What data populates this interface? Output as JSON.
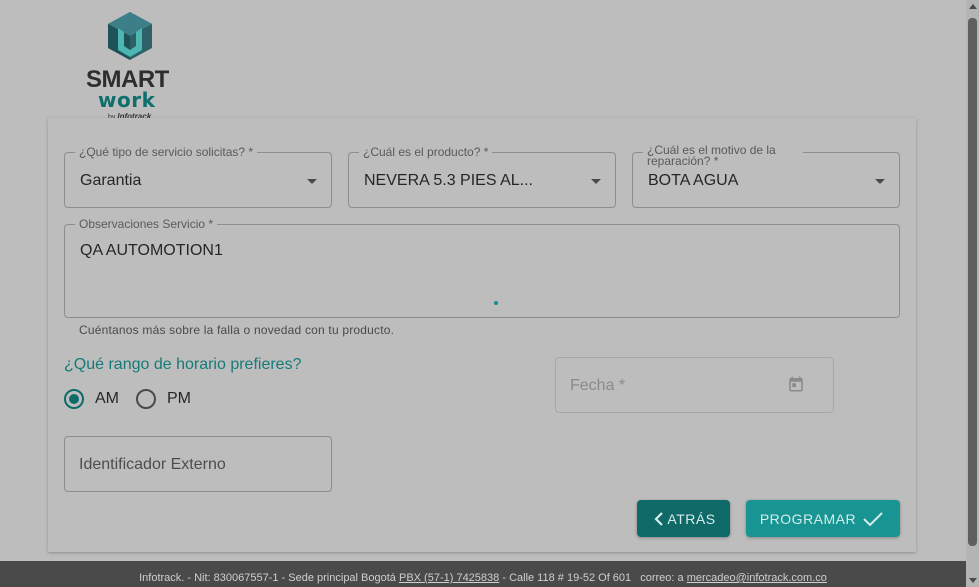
{
  "logo": {
    "word1": "SMART",
    "word2": "work",
    "by": "by",
    "brand": "Infotrack"
  },
  "form": {
    "service_type": {
      "label": "¿Qué tipo de servicio solicitas? *",
      "value": "Garantia"
    },
    "product": {
      "label": "¿Cuál es el producto? *",
      "value": "NEVERA 5.3 PIES AL..."
    },
    "reason": {
      "label": "¿Cuál es el motivo de la reparación? *",
      "value": "BOTA AGUA"
    },
    "observations": {
      "label": "Observaciones Servicio *",
      "value": "QA AUTOMOTION1",
      "helper": "Cuéntanos más sobre la falla o novedad con tu producto."
    },
    "schedule": {
      "question": "¿Qué rango de horario prefieres?",
      "options": [
        {
          "label": "AM",
          "checked": true
        },
        {
          "label": "PM",
          "checked": false
        }
      ]
    },
    "date": {
      "placeholder": "Fecha *"
    },
    "external_id": {
      "placeholder": "Identificador Externo"
    }
  },
  "buttons": {
    "back": "ATRÁS",
    "schedule": "PROGRAMAR"
  },
  "footer": {
    "text1": "Infotrack. - Nit: 830067557-1 - Sede principal Bogotá",
    "phone": "PBX (57-1) 7425838",
    "text2": "- Calle 118 # 19-52 Of 601",
    "mail_label": "correo: a",
    "email": "mercadeo@infotrack.com.co"
  },
  "colors": {
    "accent": "#157b79",
    "button_dark": "#0e6967",
    "button_primary": "#189592",
    "overlay_bg": "#bdbdbd",
    "footer_bg": "#4a4a4a"
  },
  "icons": [
    "chevron-down-icon",
    "calendar-icon",
    "chevron-left-icon",
    "check-icon",
    "smartwork-logo-icon"
  ]
}
